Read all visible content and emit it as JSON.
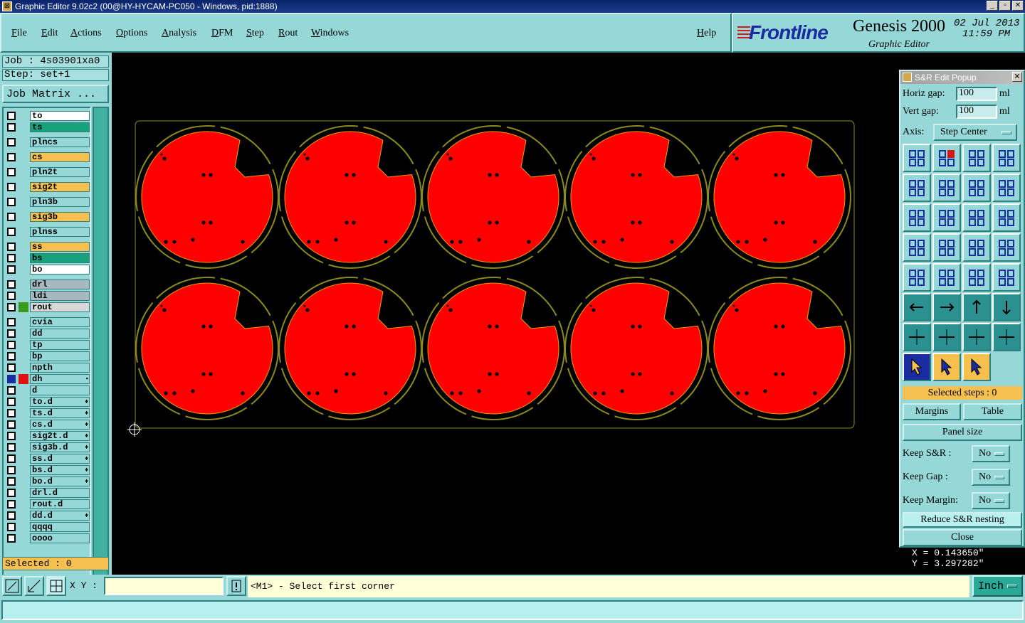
{
  "window": {
    "title": "Graphic Editor 9.02c2 (00@HY-HYCAM-PC050 - Windows, pid:1888)"
  },
  "menu": {
    "items": [
      "File",
      "Edit",
      "Actions",
      "Options",
      "Analysis",
      "DFM",
      "Step",
      "Rout",
      "Windows"
    ],
    "help": "Help"
  },
  "logo": {
    "brand": "Frontline",
    "product": "Genesis 2000",
    "subtitle": "Graphic Editor",
    "date": "02 Jul 2013",
    "time": "11:59 PM"
  },
  "job": {
    "job_label": "Job : 4s03901xa0",
    "step_label": "Step: set+1",
    "matrix_button": "Job Matrix ..."
  },
  "layers": [
    {
      "name": "to",
      "color": "#ffffff",
      "sw": ""
    },
    {
      "name": "ts",
      "color": "#16a27a",
      "sw": ""
    },
    {
      "name": "plncs",
      "color": "#96d8d8",
      "sw": ""
    },
    {
      "name": "cs",
      "color": "#f5c050",
      "sw": ""
    },
    {
      "name": "pln2t",
      "color": "#96d8d8",
      "sw": ""
    },
    {
      "name": "sig2t",
      "color": "#f5c050",
      "sw": ""
    },
    {
      "name": "pln3b",
      "color": "#96d8d8",
      "sw": ""
    },
    {
      "name": "sig3b",
      "color": "#f5c050",
      "sw": ""
    },
    {
      "name": "plnss",
      "color": "#96d8d8",
      "sw": ""
    },
    {
      "name": "ss",
      "color": "#f5c050",
      "sw": ""
    },
    {
      "name": "bs",
      "color": "#16a27a",
      "sw": ""
    },
    {
      "name": "bo",
      "color": "#ffffff",
      "sw": ""
    },
    {
      "name": "drl",
      "color": "#a8b8c0",
      "sw": ""
    },
    {
      "name": "ldi",
      "color": "#a8b8c0",
      "sw": ""
    },
    {
      "name": "rout",
      "color": "#d8d8d8",
      "sw": "#3a9a20"
    },
    {
      "name": "cvia",
      "color": "#96d8d8",
      "sw": ""
    },
    {
      "name": "dd",
      "color": "#96d8d8",
      "sw": ""
    },
    {
      "name": "tp",
      "color": "#96d8d8",
      "sw": ""
    },
    {
      "name": "bp",
      "color": "#96d8d8",
      "sw": ""
    },
    {
      "name": "npth",
      "color": "#96d8d8",
      "sw": ""
    },
    {
      "name": "dh",
      "color": "#96d8d8",
      "sw": "#e01010",
      "active": true,
      "mark": "▪"
    },
    {
      "name": "d",
      "color": "#96d8d8",
      "sw": ""
    },
    {
      "name": "to.d",
      "color": "#96d8d8",
      "sw": "",
      "mark": "♦"
    },
    {
      "name": "ts.d",
      "color": "#96d8d8",
      "sw": "",
      "mark": "♦"
    },
    {
      "name": "cs.d",
      "color": "#96d8d8",
      "sw": "",
      "mark": "♦"
    },
    {
      "name": "sig2t.d",
      "color": "#96d8d8",
      "sw": "",
      "mark": "♦"
    },
    {
      "name": "sig3b.d",
      "color": "#96d8d8",
      "sw": "",
      "mark": "♦"
    },
    {
      "name": "ss.d",
      "color": "#96d8d8",
      "sw": "",
      "mark": "♦"
    },
    {
      "name": "bs.d",
      "color": "#96d8d8",
      "sw": "",
      "mark": "♦"
    },
    {
      "name": "bo.d",
      "color": "#96d8d8",
      "sw": "",
      "mark": "♦"
    },
    {
      "name": "drl.d",
      "color": "#96d8d8",
      "sw": ""
    },
    {
      "name": "rout.d",
      "color": "#96d8d8",
      "sw": ""
    },
    {
      "name": "dd.d",
      "color": "#96d8d8",
      "sw": "",
      "mark": "♦"
    },
    {
      "name": "qqqq",
      "color": "#96d8d8",
      "sw": ""
    },
    {
      "name": "oooo",
      "color": "#96d8d8",
      "sw": ""
    }
  ],
  "selected_label": "Selected : 0",
  "popup": {
    "title": "S&R Edit Popup",
    "horiz_label": "Horiz gap:",
    "horiz_value": "100",
    "horiz_unit": "ml",
    "vert_label": "Vert  gap:",
    "vert_value": "100",
    "vert_unit": "ml",
    "axis_label": "Axis:",
    "axis_value": "Step Center",
    "selected_steps": "Selected steps : 0",
    "margins": "Margins",
    "table": "Table",
    "panel_size": "Panel size",
    "keep_sr_label": "Keep S&R   :",
    "keep_sr_value": "No",
    "keep_gap_label": "Keep Gap    :",
    "keep_gap_value": "No",
    "keep_margin_label": "Keep Margin:",
    "keep_margin_value": "No",
    "reduce": "Reduce S&R nesting",
    "close": "Close"
  },
  "coords": {
    "x": "X =  0.143650\"",
    "y": "Y =  3.297282\""
  },
  "bottom": {
    "xy_label": "X Y :",
    "message": "<M1> - Select first corner",
    "unit": "Inch"
  },
  "colors": {
    "panel": "#96d8d8",
    "board_fill": "#ff0000",
    "outline": "#8a8a20",
    "accent": "#f5c050"
  }
}
